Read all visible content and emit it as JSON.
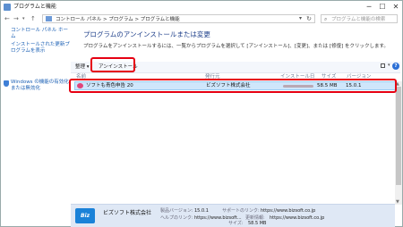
{
  "window": {
    "title": "プログラムと機能",
    "minimize": "─",
    "maximize": "☐",
    "close": "✕"
  },
  "address": {
    "breadcrumb": "コントロール パネル  >  プログラム  >  プログラムと機能",
    "search_placeholder": "プログラムと機能の検索"
  },
  "sidebar": {
    "items": [
      {
        "label": "コントロール パネル ホーム"
      },
      {
        "label": "インストールされた更新プログラムを表示"
      },
      {
        "label": "Windows の機能の有効化または無効化"
      }
    ]
  },
  "main": {
    "heading": "プログラムのアンインストールまたは変更",
    "description": "プログラムをアンインストールするには、一覧からプログラムを選択して [アンインストール]、[変更]、または [修復] をクリックします。"
  },
  "toolbar": {
    "organize": "整理 ▾",
    "uninstall": "アンインストール"
  },
  "columns": [
    "名前",
    "発行元",
    "インストール日",
    "サイズ",
    "バージョン"
  ],
  "rows": [
    {
      "name": "ソフトも青色申告 20",
      "publisher": "ビズソフト株式会社",
      "size": "58.5 MB",
      "version": "15.0.1"
    }
  ],
  "details": {
    "logo_text": "Biz",
    "publisher": "ビズソフト株式会社",
    "version_label": "製品バージョン:",
    "version": "15.0.1",
    "support_label": "サポートのリンク:",
    "support_url": "https://www.bizsoft.co.jp",
    "help_label": "ヘルプのリンク:",
    "help_url": "https://www.bizsoft...",
    "update_label": "更新情報:",
    "update_url": "https://www.bizsoft.co.jp",
    "size_label": "サイズ:",
    "size": "58.5 MB"
  },
  "colors": {
    "highlight": "#e60012",
    "selection": "#cfe6fb",
    "details_bg": "#dfe8f5",
    "link": "#1a5fb4"
  }
}
